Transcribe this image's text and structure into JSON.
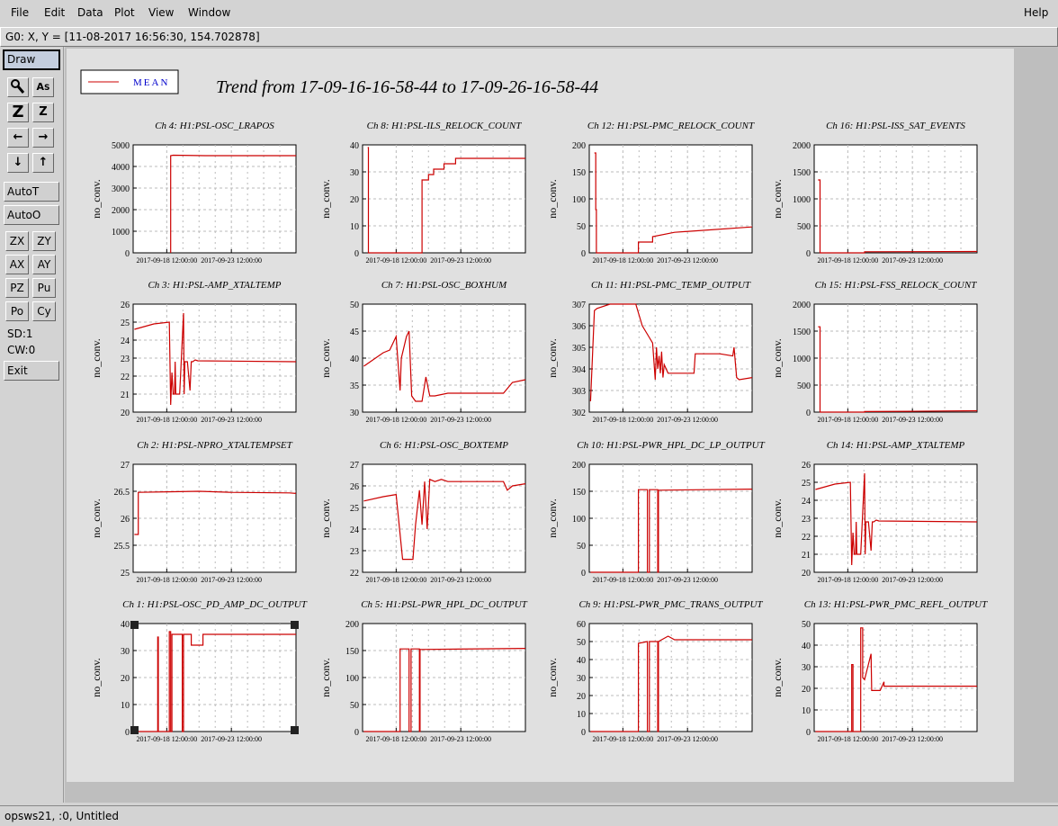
{
  "menubar": {
    "items": [
      "File",
      "Edit",
      "Data",
      "Plot",
      "View",
      "Window"
    ],
    "help": "Help"
  },
  "coord_bar": {
    "text": "G0: X, Y = [11-08-2017 16:56:30, 154.702878]"
  },
  "toolbar": {
    "draw": "Draw",
    "zoom_icons": [
      [
        "magnifier-icon",
        "text-size-icon"
      ],
      [
        "zoom-z-large-icon",
        "zoom-z-small-icon"
      ],
      [
        "arrow-left-icon",
        "arrow-right-icon"
      ],
      [
        "arrow-down-icon",
        "arrow-up-icon"
      ]
    ],
    "autot": "AutoT",
    "autoo": "AutoO",
    "small_buttons": [
      [
        "ZX",
        "ZY"
      ],
      [
        "AX",
        "AY"
      ],
      [
        "PZ",
        "Pu"
      ],
      [
        "Po",
        "Cy"
      ]
    ],
    "sd": "SD:1",
    "cw": "CW:0",
    "exit": "Exit"
  },
  "legend": {
    "label": "MEAN",
    "color": "#cc0000"
  },
  "main_title": "Trend from 17-09-16-16-58-44 to 17-09-26-16-58-44",
  "status": {
    "text": "opsws21, :0, Untitled"
  },
  "colors": {
    "trace": "#cc0000",
    "grid": "#bbbbbb"
  },
  "chart_data": [
    {
      "type": "line",
      "title": "Ch 4: H1:PSL-OSC_LRAPOS",
      "ylabel": "no_conv.",
      "ylim": [
        0,
        5000
      ],
      "yticks": [
        "0",
        "1000",
        "2000",
        "3000",
        "4000",
        "5000"
      ],
      "xticks": [
        "2017-09-18 12:00:00",
        "2017-09-23 12:00:00"
      ],
      "series": [
        {
          "x": [
            0.3,
            0.3,
            0.5,
            3.0,
            10.0
          ],
          "y": [
            0,
            4500,
            4520,
            4500,
            4500
          ]
        }
      ]
    },
    {
      "type": "line",
      "title": "Ch 8: H1:PSL-ILS_RELOCK_COUNT",
      "ylabel": "no_conv.",
      "ylim": [
        0,
        40
      ],
      "yticks": [
        "0",
        "10",
        "20",
        "30",
        "40"
      ],
      "xticks": [
        "2017-09-18 12:00:00",
        "2017-09-23 12:00:00"
      ],
      "series": [
        {
          "x": [
            -2.2,
            -2.15,
            -2.15,
            2.0,
            2.0,
            2.5,
            2.5,
            2.9,
            2.9,
            3.7,
            3.7,
            4.6,
            4.6,
            10.0
          ],
          "y": [
            39,
            39,
            0,
            0,
            27,
            27,
            29,
            29,
            31,
            31,
            33,
            33,
            35,
            35
          ]
        }
      ]
    },
    {
      "type": "line",
      "title": "Ch 12: H1:PSL-PMC_RELOCK_COUNT",
      "ylabel": "no_conv.",
      "ylim": [
        0,
        200
      ],
      "yticks": [
        "0",
        "50",
        "100",
        "150",
        "200"
      ],
      "xticks": [
        "2017-09-18 12:00:00",
        "2017-09-23 12:00:00"
      ],
      "series": [
        {
          "x": [
            -2.2,
            -2.1,
            -2.1,
            -2.05,
            -2.05,
            1.2,
            1.2,
            2.3,
            2.3,
            4.0,
            10.0
          ],
          "y": [
            185,
            185,
            80,
            80,
            0,
            0,
            20,
            20,
            30,
            38,
            48
          ]
        }
      ]
    },
    {
      "type": "line",
      "title": "Ch 16: H1:PSL-ISS_SAT_EVENTS",
      "ylabel": "no_conv.",
      "ylim": [
        0,
        2000
      ],
      "yticks": [
        "0",
        "500",
        "1000",
        "1500",
        "2000"
      ],
      "xticks": [
        "2017-09-18 12:00:00",
        "2017-09-23 12:00:00"
      ],
      "series": [
        {
          "x": [
            -2.3,
            -2.15,
            -2.15,
            1.3,
            1.3,
            10.0
          ],
          "y": [
            1350,
            1350,
            0,
            0,
            20,
            25
          ]
        }
      ]
    },
    {
      "type": "line",
      "title": "Ch 3: H1:PSL-AMP_XTALTEMP",
      "ylabel": "no_conv.",
      "ylim": [
        20,
        26
      ],
      "yticks": [
        "20",
        "21",
        "22",
        "23",
        "24",
        "25",
        "26"
      ],
      "xticks": [
        "2017-09-18 12:00:00",
        "2017-09-23 12:00:00"
      ],
      "series": [
        {
          "x": [
            -2.5,
            -1.0,
            0.2,
            0.3,
            0.4,
            0.5,
            0.6,
            0.65,
            0.7,
            1.0,
            1.3,
            1.35,
            1.4,
            1.6,
            1.8,
            1.9,
            2.0,
            2.2,
            2.4,
            10.0
          ],
          "y": [
            24.6,
            24.9,
            25.0,
            20.4,
            22.2,
            21.0,
            21.0,
            22.8,
            21.0,
            21.0,
            25.5,
            21.0,
            22.8,
            22.8,
            21.2,
            22.8,
            22.8,
            22.9,
            22.85,
            22.8
          ]
        }
      ]
    },
    {
      "type": "line",
      "title": "Ch 7: H1:PSL-OSC_BOXHUM",
      "ylabel": "no_conv.",
      "ylim": [
        30,
        50
      ],
      "yticks": [
        "30",
        "35",
        "40",
        "45",
        "50"
      ],
      "xticks": [
        "2017-09-18 12:00:00",
        "2017-09-23 12:00:00"
      ],
      "series": [
        {
          "x": [
            -2.5,
            -1.0,
            -0.5,
            0.0,
            0.3,
            0.4,
            0.8,
            1.0,
            1.2,
            1.5,
            2.0,
            2.3,
            2.6,
            3.0,
            4.0,
            6.0,
            8.3,
            9.0,
            10.0
          ],
          "y": [
            38.5,
            41.0,
            41.5,
            44.0,
            34.0,
            40.0,
            44.0,
            45.0,
            33.0,
            32.0,
            32.0,
            36.5,
            33.0,
            33.0,
            33.5,
            33.5,
            33.5,
            35.5,
            36.0
          ]
        }
      ]
    },
    {
      "type": "line",
      "title": "Ch 11: H1:PSL-PMC_TEMP_OUTPUT",
      "ylabel": "no_conv.",
      "ylim": [
        302,
        307
      ],
      "yticks": [
        "302",
        "303",
        "304",
        "305",
        "306",
        "307"
      ],
      "xticks": [
        "2017-09-18 12:00:00",
        "2017-09-23 12:00:00"
      ],
      "series": [
        {
          "x": [
            -2.5,
            -2.2,
            -2.0,
            -1.0,
            1.0,
            1.5,
            2.0,
            2.3,
            2.5,
            2.6,
            2.7,
            2.8,
            2.9,
            3.0,
            3.1,
            3.2,
            3.5,
            4.5,
            5.5,
            5.6,
            7.5,
            8.5,
            8.6,
            8.8,
            9.0,
            10.0
          ],
          "y": [
            302.5,
            306.7,
            306.8,
            307.0,
            307.0,
            306.0,
            305.5,
            305.2,
            303.5,
            305.0,
            304.0,
            304.6,
            303.8,
            304.8,
            303.6,
            304.2,
            303.8,
            303.8,
            303.8,
            304.7,
            304.7,
            304.6,
            305.0,
            303.6,
            303.5,
            303.6
          ]
        }
      ]
    },
    {
      "type": "line",
      "title": "Ch 15: H1:PSL-FSS_RELOCK_COUNT",
      "ylabel": "no_conv.",
      "ylim": [
        0,
        2000
      ],
      "yticks": [
        "0",
        "500",
        "1000",
        "1500",
        "2000"
      ],
      "xticks": [
        "2017-09-18 12:00:00",
        "2017-09-23 12:00:00"
      ],
      "series": [
        {
          "x": [
            -2.3,
            -2.15,
            -2.15,
            1.3,
            1.3,
            5.0,
            10.0
          ],
          "y": [
            1580,
            1580,
            0,
            0,
            10,
            15,
            25
          ]
        }
      ]
    },
    {
      "type": "line",
      "title": "Ch 2: H1:PSL-NPRO_XTALTEMPSET",
      "ylabel": "no_conv.",
      "ylim": [
        25,
        27
      ],
      "yticks": [
        "25",
        "25.5",
        "26",
        "26.5",
        "27"
      ],
      "xticks": [
        "2017-09-18 12:00:00",
        "2017-09-23 12:00:00"
      ],
      "series": [
        {
          "x": [
            -2.5,
            -2.2,
            -2.2,
            0.0,
            2.5,
            5.0,
            9.5,
            10.0
          ],
          "y": [
            25.7,
            25.7,
            26.48,
            26.49,
            26.5,
            26.48,
            26.47,
            26.46
          ]
        }
      ]
    },
    {
      "type": "line",
      "title": "Ch 6: H1:PSL-OSC_BOXTEMP",
      "ylabel": "no_conv.",
      "ylim": [
        22,
        27
      ],
      "yticks": [
        "22",
        "23",
        "24",
        "25",
        "26",
        "27"
      ],
      "xticks": [
        "2017-09-18 12:00:00",
        "2017-09-23 12:00:00"
      ],
      "series": [
        {
          "x": [
            -2.5,
            -1.0,
            0.0,
            0.5,
            1.3,
            1.5,
            1.8,
            2.0,
            2.2,
            2.4,
            2.6,
            3.0,
            3.5,
            4.0,
            6.0,
            8.3,
            8.6,
            9.0,
            10.0
          ],
          "y": [
            25.3,
            25.5,
            25.6,
            22.6,
            22.6,
            24.2,
            25.8,
            24.2,
            26.2,
            24.0,
            26.3,
            26.2,
            26.3,
            26.2,
            26.2,
            26.2,
            25.8,
            26.0,
            26.1
          ]
        }
      ]
    },
    {
      "type": "line",
      "title": "Ch 10: H1:PSL-PWR_HPL_DC_LP_OUTPUT",
      "ylabel": "no_conv.",
      "ylim": [
        0,
        200
      ],
      "yticks": [
        "0",
        "50",
        "100",
        "150",
        "200"
      ],
      "xticks": [
        "2017-09-18 12:00:00",
        "2017-09-23 12:00:00"
      ],
      "series": [
        {
          "x": [
            -2.5,
            1.2,
            1.2,
            1.9,
            1.9,
            2.05,
            2.05,
            2.7,
            2.7,
            2.75,
            2.75,
            10.0
          ],
          "y": [
            0,
            0,
            153,
            153,
            0,
            0,
            153,
            153,
            0,
            0,
            152,
            154
          ]
        }
      ]
    },
    {
      "type": "line",
      "title": "Ch 14: H1:PSL-AMP_XTALTEMP",
      "ylabel": "no_conv.",
      "ylim": [
        20,
        26
      ],
      "yticks": [
        "20",
        "21",
        "22",
        "23",
        "24",
        "25",
        "26"
      ],
      "xticks": [
        "2017-09-18 12:00:00",
        "2017-09-23 12:00:00"
      ],
      "series": [
        {
          "x": [
            -2.5,
            -1.0,
            0.2,
            0.3,
            0.4,
            0.5,
            0.6,
            0.65,
            0.7,
            1.0,
            1.3,
            1.35,
            1.4,
            1.6,
            1.8,
            1.9,
            2.0,
            2.2,
            2.4,
            10.0
          ],
          "y": [
            24.6,
            24.9,
            25.0,
            20.4,
            22.2,
            21.0,
            21.0,
            22.8,
            21.0,
            21.0,
            25.5,
            21.0,
            22.8,
            22.8,
            21.2,
            22.8,
            22.8,
            22.9,
            22.85,
            22.8
          ]
        }
      ]
    },
    {
      "type": "line",
      "title": "Ch 1: H1:PSL-OSC_PD_AMP_DC_OUTPUT",
      "ylabel": "no_conv.",
      "ylim": [
        0,
        40
      ],
      "yticks": [
        "0",
        "10",
        "20",
        "30",
        "40"
      ],
      "xticks": [
        "2017-09-18 12:00:00",
        "2017-09-23 12:00:00"
      ],
      "series": [
        {
          "x": [
            -2.5,
            -0.7,
            -0.7,
            -0.65,
            -0.65,
            0.2,
            0.2,
            0.3,
            0.3,
            0.4,
            0.4,
            1.2,
            1.2,
            1.3,
            1.3,
            1.9,
            1.9,
            2.0,
            2.0,
            2.8,
            2.8,
            10.0
          ],
          "y": [
            0,
            0,
            35,
            35,
            0,
            0,
            37,
            37,
            0,
            0,
            36,
            36,
            0,
            0,
            36,
            36,
            32,
            32,
            32,
            32,
            36,
            36
          ]
        }
      ]
    },
    {
      "type": "line",
      "title": "Ch 5: H1:PSL-PWR_HPL_DC_OUTPUT",
      "ylabel": "no_conv.",
      "ylim": [
        0,
        200
      ],
      "yticks": [
        "0",
        "50",
        "100",
        "150",
        "200"
      ],
      "xticks": [
        "2017-09-18 12:00:00",
        "2017-09-23 12:00:00"
      ],
      "series": [
        {
          "x": [
            -2.5,
            0.3,
            0.3,
            1.0,
            1.0,
            1.15,
            1.15,
            1.8,
            1.8,
            1.85,
            1.85,
            10.0
          ],
          "y": [
            0,
            0,
            153,
            153,
            0,
            0,
            153,
            153,
            0,
            0,
            152,
            154
          ]
        }
      ]
    },
    {
      "type": "line",
      "title": "Ch 9: H1:PSL-PWR_PMC_TRANS_OUTPUT",
      "ylabel": "no_conv.",
      "ylim": [
        0,
        60
      ],
      "yticks": [
        "0",
        "10",
        "20",
        "30",
        "40",
        "50",
        "60"
      ],
      "xticks": [
        "2017-09-18 12:00:00",
        "2017-09-23 12:00:00"
      ],
      "series": [
        {
          "x": [
            -2.5,
            1.2,
            1.2,
            1.9,
            1.9,
            2.05,
            2.05,
            2.7,
            2.7,
            2.75,
            2.75,
            3.5,
            4.0,
            10.0
          ],
          "y": [
            0,
            0,
            49,
            50,
            0,
            0,
            50,
            50,
            0,
            0,
            50,
            53,
            51,
            51
          ]
        }
      ]
    },
    {
      "type": "line",
      "title": "Ch 13: H1:PSL-PWR_PMC_REFL_OUTPUT",
      "ylabel": "no_conv.",
      "ylim": [
        0,
        50
      ],
      "yticks": [
        "0",
        "10",
        "20",
        "30",
        "40",
        "50"
      ],
      "xticks": [
        "2017-09-18 12:00:00",
        "2017-09-23 12:00:00"
      ],
      "series": [
        {
          "x": [
            -2.5,
            0.3,
            0.3,
            0.4,
            0.4,
            1.0,
            1.0,
            1.15,
            1.15,
            1.3,
            1.8,
            1.8,
            1.85,
            1.85,
            2.5,
            2.8,
            2.8,
            10.0
          ],
          "y": [
            0,
            0,
            31,
            31,
            0,
            0,
            48,
            48,
            25,
            24,
            36,
            36,
            19,
            19,
            19,
            23,
            21,
            21
          ]
        }
      ]
    }
  ]
}
